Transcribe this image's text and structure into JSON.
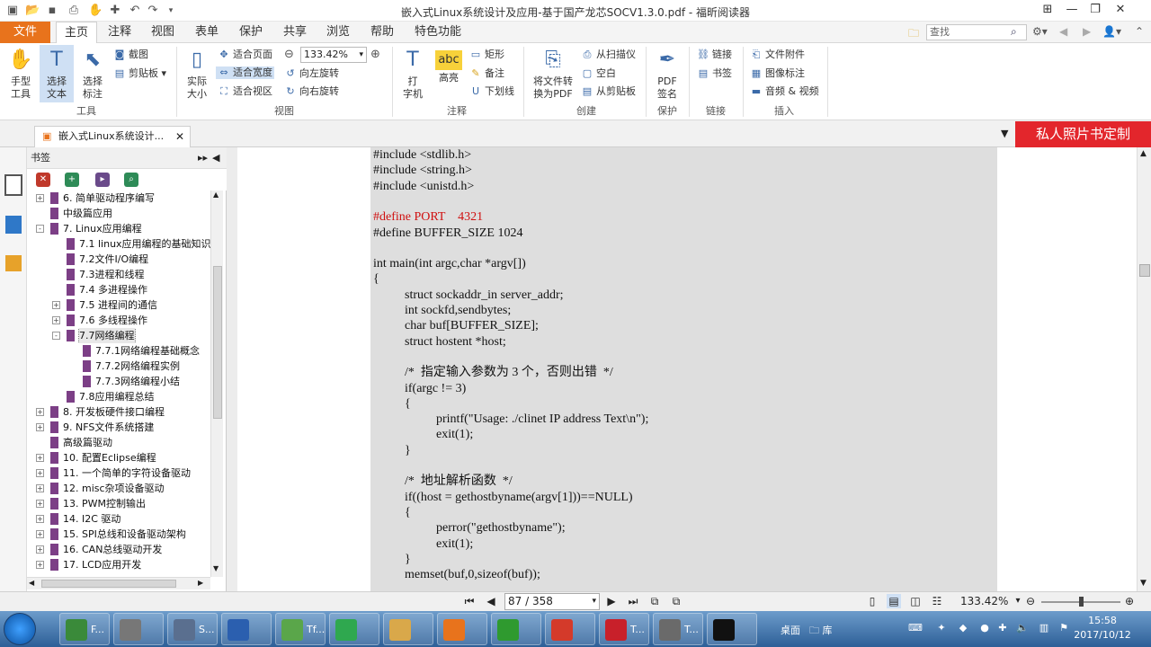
{
  "window": {
    "title": "嵌入式Linux系统设计及应用-基于国产龙芯SOCV1.3.0.pdf - 福昕阅读器"
  },
  "ribbon_tabs": [
    "文件",
    "主页",
    "注释",
    "视图",
    "表单",
    "保护",
    "共享",
    "浏览",
    "帮助",
    "特色功能"
  ],
  "search": {
    "placeholder": "查找"
  },
  "ribbon": {
    "hand": "手型\n工具",
    "select_text": "选择\n文本",
    "select_annot": "选择\n标注",
    "screenshot": "截图",
    "clipboard": "剪贴板",
    "tools_group": "工具",
    "actual_size": "实际\n大小",
    "fit_page": "适合页面",
    "fit_width": "适合宽度",
    "fit_view": "适合视区",
    "zoom_value": "133.42%",
    "rotate_left": "向左旋转",
    "rotate_right": "向右旋转",
    "view_group": "视图",
    "typewriter": "打\n字机",
    "highlight": "高亮",
    "rect": "矩形",
    "note": "备注",
    "underline": "下划线",
    "annot_group": "注释",
    "convert": "将文件转\n换为PDF",
    "from_scanner": "从扫描仪",
    "blank": "空白",
    "from_clipboard": "从剪贴板",
    "create_group": "创建",
    "pdf_sign": "PDF\n签名",
    "protect_group": "保护",
    "link": "链接",
    "bookmark": "书签",
    "link_group": "链接",
    "file_attach": "文件附件",
    "image_annot": "图像标注",
    "audio_video": "音频 & 视频",
    "insert_group": "插入"
  },
  "document_tab": {
    "label": "嵌入式Linux系统设计..."
  },
  "promo": {
    "label": "私人照片书定制"
  },
  "bookmarks_panel": {
    "title": "书签",
    "items": [
      {
        "label": "6. 简单驱动程序编写",
        "level": 0,
        "toggle": "+"
      },
      {
        "label": "中级篇应用",
        "level": 0,
        "toggle": ""
      },
      {
        "label": "7. Linux应用编程",
        "level": 0,
        "toggle": "-"
      },
      {
        "label": "7.1 linux应用编程的基础知识",
        "level": 1,
        "toggle": ""
      },
      {
        "label": "7.2文件I/O编程",
        "level": 1,
        "toggle": ""
      },
      {
        "label": "7.3进程和线程",
        "level": 1,
        "toggle": ""
      },
      {
        "label": "7.4 多进程操作",
        "level": 1,
        "toggle": ""
      },
      {
        "label": "7.5 进程间的通信",
        "level": 1,
        "toggle": "+"
      },
      {
        "label": "7.6 多线程操作",
        "level": 1,
        "toggle": "+"
      },
      {
        "label": "7.7网络编程",
        "level": 1,
        "toggle": "-",
        "selected": true
      },
      {
        "label": "7.7.1网络编程基础概念",
        "level": 2,
        "toggle": ""
      },
      {
        "label": "7.7.2网络编程实例",
        "level": 2,
        "toggle": ""
      },
      {
        "label": "7.7.3网络编程小结",
        "level": 2,
        "toggle": ""
      },
      {
        "label": "7.8应用编程总结",
        "level": 1,
        "toggle": ""
      },
      {
        "label": "8. 开发板硬件接口编程",
        "level": 0,
        "toggle": "+"
      },
      {
        "label": "9. NFS文件系统搭建",
        "level": 0,
        "toggle": "+"
      },
      {
        "label": "高级篇驱动",
        "level": 0,
        "toggle": ""
      },
      {
        "label": "10. 配置Eclipse编程",
        "level": 0,
        "toggle": "+"
      },
      {
        "label": "11. 一个简单的字符设备驱动",
        "level": 0,
        "toggle": "+"
      },
      {
        "label": "12. misc杂项设备驱动",
        "level": 0,
        "toggle": "+"
      },
      {
        "label": "13. PWM控制输出",
        "level": 0,
        "toggle": "+"
      },
      {
        "label": "14. I2C 驱动",
        "level": 0,
        "toggle": "+"
      },
      {
        "label": "15. SPI总线和设备驱动架构",
        "level": 0,
        "toggle": "+"
      },
      {
        "label": "16. CAN总线驱动开发",
        "level": 0,
        "toggle": "+"
      },
      {
        "label": "17. LCD应用开发",
        "level": 0,
        "toggle": "+"
      }
    ]
  },
  "code_lines": [
    {
      "text": "#include <stdlib.h>",
      "indent": 0,
      "red": false
    },
    {
      "text": "#include <string.h>",
      "indent": 0,
      "red": false
    },
    {
      "text": "#include <unistd.h>",
      "indent": 0,
      "red": false
    },
    {
      "text": "",
      "indent": 0,
      "red": false
    },
    {
      "text": "#define PORT    4321",
      "indent": 0,
      "red": true
    },
    {
      "text": "#define BUFFER_SIZE 1024",
      "indent": 0,
      "red": false
    },
    {
      "text": "",
      "indent": 0,
      "red": false
    },
    {
      "text": "int main(int argc,char *argv[])",
      "indent": 0,
      "red": false
    },
    {
      "text": "{",
      "indent": 0,
      "red": false
    },
    {
      "text": "struct sockaddr_in server_addr;",
      "indent": 1,
      "red": false
    },
    {
      "text": "int sockfd,sendbytes;",
      "indent": 1,
      "red": false
    },
    {
      "text": "char buf[BUFFER_SIZE];",
      "indent": 1,
      "red": false
    },
    {
      "text": "struct hostent *host;",
      "indent": 1,
      "red": false
    },
    {
      "text": "",
      "indent": 0,
      "red": false
    },
    {
      "text": "/*  指定输入参数为 3 个，否则出错  */",
      "indent": 1,
      "red": false
    },
    {
      "text": "if(argc != 3)",
      "indent": 1,
      "red": false
    },
    {
      "text": "{",
      "indent": 1,
      "red": false
    },
    {
      "text": "printf(\"Usage: ./clinet IP address Text\\n\");",
      "indent": 2,
      "red": false
    },
    {
      "text": "exit(1);",
      "indent": 2,
      "red": false
    },
    {
      "text": "}",
      "indent": 1,
      "red": false
    },
    {
      "text": "",
      "indent": 0,
      "red": false
    },
    {
      "text": "/*  地址解析函数  */",
      "indent": 1,
      "red": false
    },
    {
      "text": "if((host = gethostbyname(argv[1]))==NULL)",
      "indent": 1,
      "red": false
    },
    {
      "text": "{",
      "indent": 1,
      "red": false
    },
    {
      "text": "perror(\"gethostbyname\");",
      "indent": 2,
      "red": false
    },
    {
      "text": "exit(1);",
      "indent": 2,
      "red": false
    },
    {
      "text": "}",
      "indent": 1,
      "red": false
    },
    {
      "text": "memset(buf,0,sizeof(buf));",
      "indent": 1,
      "red": false
    }
  ],
  "status": {
    "page": "87 / 358",
    "zoom": "133.42%"
  },
  "taskbar": {
    "items": [
      {
        "label": "F...",
        "color": "#3a8a3a"
      },
      {
        "label": "",
        "color": "#777777"
      },
      {
        "label": "S...",
        "color": "#5a6f8f"
      },
      {
        "label": "",
        "color": "#2b5faf"
      },
      {
        "label": "Tf...",
        "color": "#5aa64a"
      },
      {
        "label": "",
        "color": "#2fa84f"
      },
      {
        "label": "",
        "color": "#d9a84a"
      },
      {
        "label": "",
        "color": "#e8731c"
      },
      {
        "label": "",
        "color": "#2f9a2f"
      },
      {
        "label": "",
        "color": "#d43a2a"
      },
      {
        "label": "T...",
        "color": "#c8202a"
      },
      {
        "label": "T...",
        "color": "#6a6a6a"
      },
      {
        "label": "",
        "color": "#111111"
      }
    ],
    "tray_labels": [
      "桌面",
      "库"
    ],
    "time": "15:58",
    "date": "2017/10/12"
  }
}
